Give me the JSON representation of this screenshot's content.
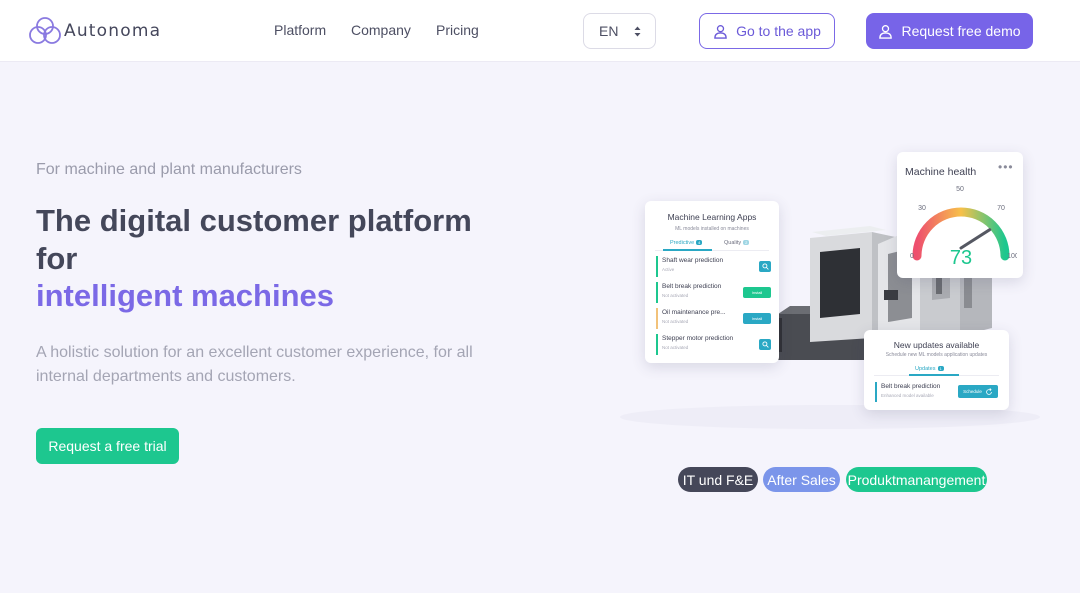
{
  "brand": {
    "name": "Autonoma"
  },
  "nav": {
    "platform": "Platform",
    "company": "Company",
    "pricing": "Pricing"
  },
  "language": {
    "selected": "EN"
  },
  "header_buttons": {
    "go_to_app": "Go to the app",
    "request_demo": "Request free demo"
  },
  "hero": {
    "eyebrow": "For machine and plant manufacturers",
    "headline": "The digital customer platform for",
    "headline_accent": "intelligent machines",
    "lead": "A holistic solution for an excellent customer experience, for all internal departments and customers.",
    "cta": "Request a free trial"
  },
  "ml_card": {
    "title": "Machine Learning Apps",
    "subtitle": "ML models installed on machines",
    "tab_predictive": "Predictive",
    "tab_predictive_count": "4",
    "tab_quality": "Quality",
    "tab_quality_count": "2",
    "rows": [
      {
        "name": "Shaft wear prediction",
        "status": "Active",
        "color": "#1dc78f"
      },
      {
        "name": "Belt break prediction",
        "status": "Not activated",
        "action": "Install",
        "color": "#1dc78f"
      },
      {
        "name": "Oil maintenance pre...",
        "status": "Not activated",
        "action": "Install",
        "color": "#f2c27a"
      },
      {
        "name": "Stepper motor prediction",
        "status": "Not activated",
        "color": "#1dc78f"
      }
    ]
  },
  "machine_health": {
    "title": "Machine health",
    "value": 73,
    "min": 0,
    "max": 100,
    "ticks": [
      "0",
      "30",
      "50",
      "70",
      "100"
    ]
  },
  "updates_card": {
    "title": "New updates available",
    "subtitle": "Schedule new ML models application updates",
    "tab": "Updates",
    "tab_count": "1",
    "row_name": "Belt break prediction",
    "row_status": "Enhanced model available",
    "row_action": "Schedule"
  },
  "tags": {
    "it": "IT und F&E",
    "after_sales": "After Sales",
    "product": "Produktmanangement"
  },
  "colors": {
    "accent": "#7764e8",
    "green": "#1dc78f",
    "teal": "#2aa8c4",
    "dark": "#454759",
    "blue": "#7b95ea"
  },
  "icons": {
    "logo": "cloud-logo-icon",
    "user": "user-icon",
    "select": "select-arrows-icon",
    "search": "search-icon"
  }
}
